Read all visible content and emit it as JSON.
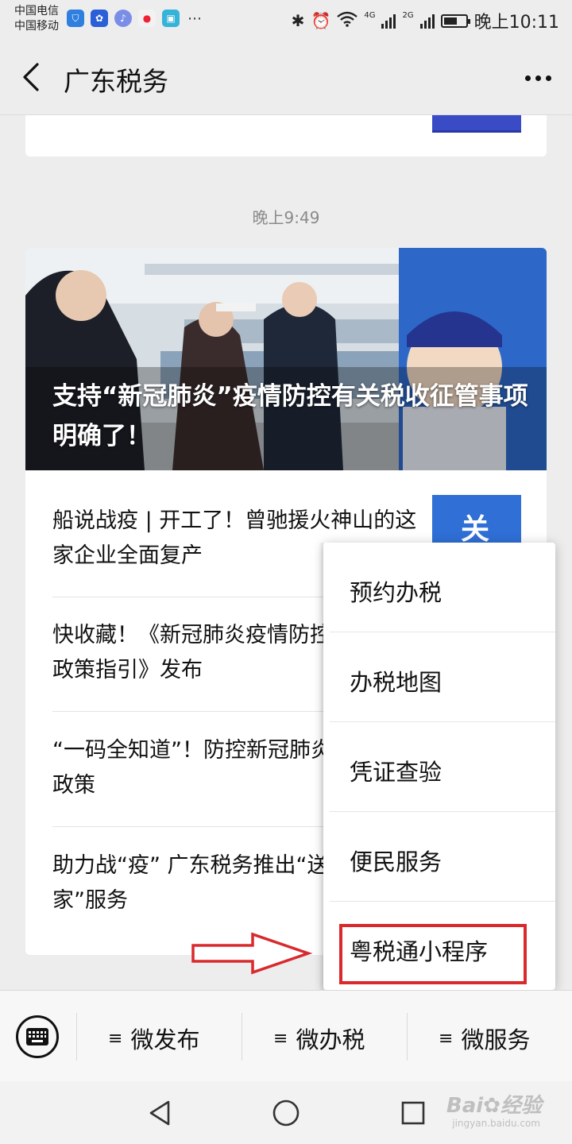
{
  "status_bar": {
    "carrier_1": "中国电信",
    "carrier_2": "中国移动",
    "time": "晚上10:11",
    "net_1": "4G",
    "net_2": "2G"
  },
  "nav": {
    "title": "广东税务",
    "back_icon": "chevron-left-icon",
    "more_icon": "more-dots-icon"
  },
  "message": {
    "timestamp": "晚上9:49",
    "hero_title": "支持“新冠肺炎”疫情防控有关税收征管事项明确了！",
    "items": [
      {
        "title": "船说战疫 | 开工了！曾驰援火神山的这家企业全面复产"
      },
      {
        "title": "快收藏！《新冠肺炎疫情防控税收优惠政策指引》发布"
      },
      {
        "title": "“一码全知道”！防控新冠肺炎税收优惠政策"
      },
      {
        "title": "助力战“疫” 广东税务推出“送发票到家”服务"
      }
    ],
    "thumb_text": "关"
  },
  "popup_menu": {
    "items": [
      {
        "label": "预约办税"
      },
      {
        "label": "办税地图"
      },
      {
        "label": "凭证查验"
      },
      {
        "label": "便民服务"
      },
      {
        "label": "粤税通小程序"
      }
    ],
    "highlight_color": "#d9292d"
  },
  "bottom_menu": {
    "tabs": [
      {
        "label": "微发布"
      },
      {
        "label": "微办税"
      },
      {
        "label": "微服务"
      }
    ],
    "hamburger": "≡"
  },
  "watermark": {
    "text": "Bai",
    "suffix": "经验",
    "sub": "jingyan.baidu.com"
  }
}
